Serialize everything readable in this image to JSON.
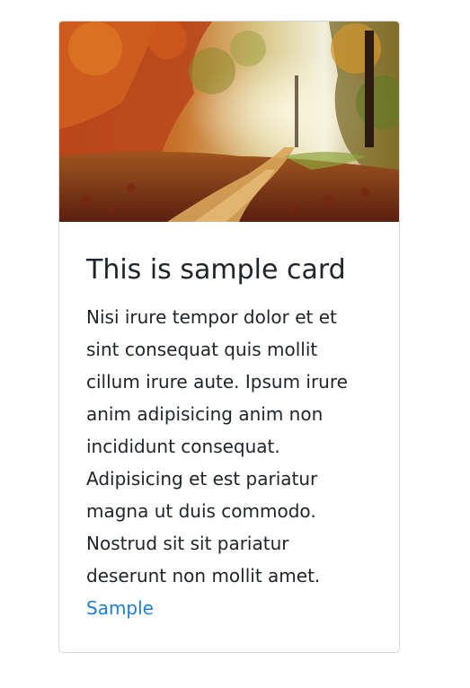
{
  "card": {
    "image": {
      "subject": "autumn forest path"
    },
    "title": "This is sample card",
    "text": "Nisi irure tempor dolor et et sint consequat quis mollit cillum irure aute. Ipsum irure anim adipisicing anim non incididunt consequat. Adipisicing et est pariatur magna ut duis commodo. Nostrud sit sit pariatur deserunt non mollit amet.",
    "link_label": "Sample"
  },
  "colors": {
    "link": "#1f7fd6",
    "text": "#212529",
    "border": "#d9d9d9"
  }
}
